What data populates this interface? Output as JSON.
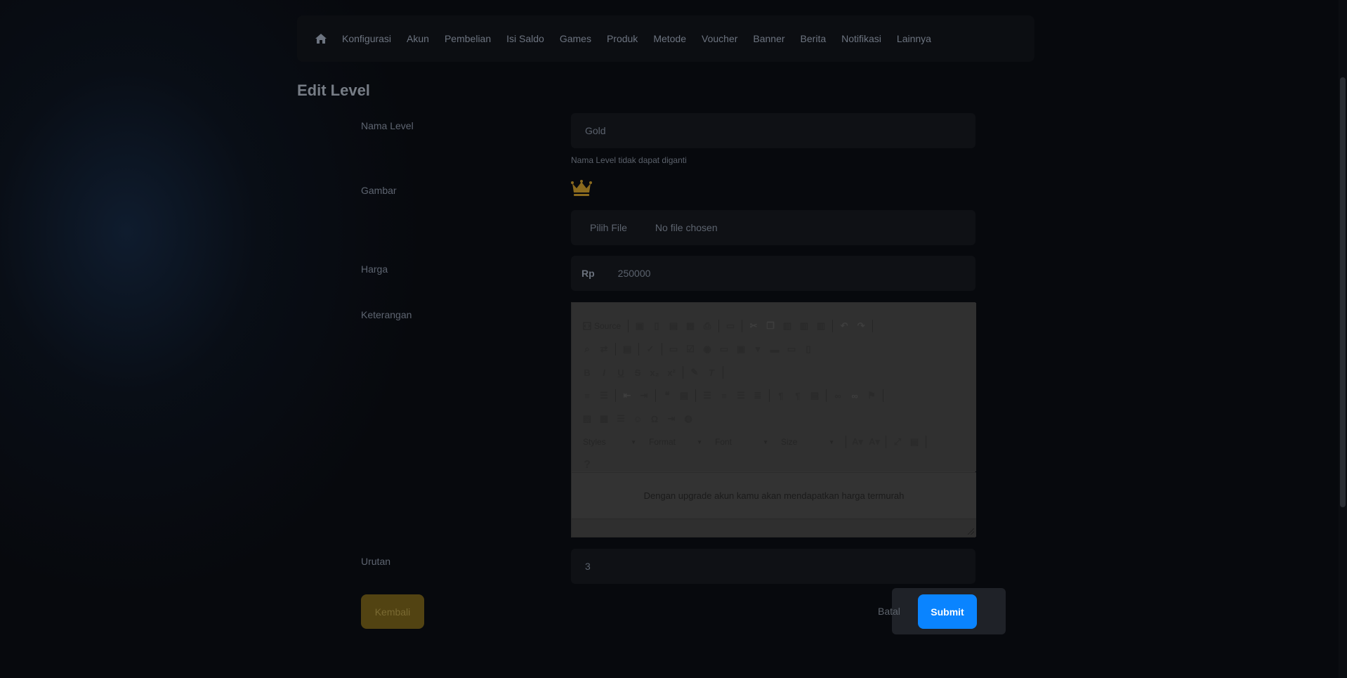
{
  "nav": {
    "home_icon": "home-icon",
    "items": [
      "Konfigurasi",
      "Akun",
      "Pembelian",
      "Isi Saldo",
      "Games",
      "Produk",
      "Metode",
      "Voucher",
      "Banner",
      "Berita",
      "Notifikasi",
      "Lainnya"
    ]
  },
  "page": {
    "title": "Edit Level"
  },
  "form": {
    "nama_level": {
      "label": "Nama Level",
      "value": "Gold",
      "hint": "Nama Level tidak dapat diganti"
    },
    "gambar": {
      "label": "Gambar",
      "image_icon": "crown-icon",
      "file_button": "Pilih File",
      "file_status": "No file chosen"
    },
    "harga": {
      "label": "Harga",
      "prefix": "Rp",
      "value": "250000"
    },
    "keterangan": {
      "label": "Keterangan",
      "toolbar": {
        "source": "Source",
        "styles": "Styles",
        "format": "Format",
        "font": "Font",
        "size": "Size"
      },
      "content": "Dengan upgrade akun kamu akan mendapatkan harga termurah"
    },
    "urutan": {
      "label": "Urutan",
      "value": "3"
    }
  },
  "actions": {
    "back": "Kembali",
    "cancel": "Batal",
    "submit": "Submit"
  },
  "colors": {
    "submit": "#0a84ff",
    "back": "#524312",
    "crown": "#b8860b",
    "background": "#07090d"
  }
}
